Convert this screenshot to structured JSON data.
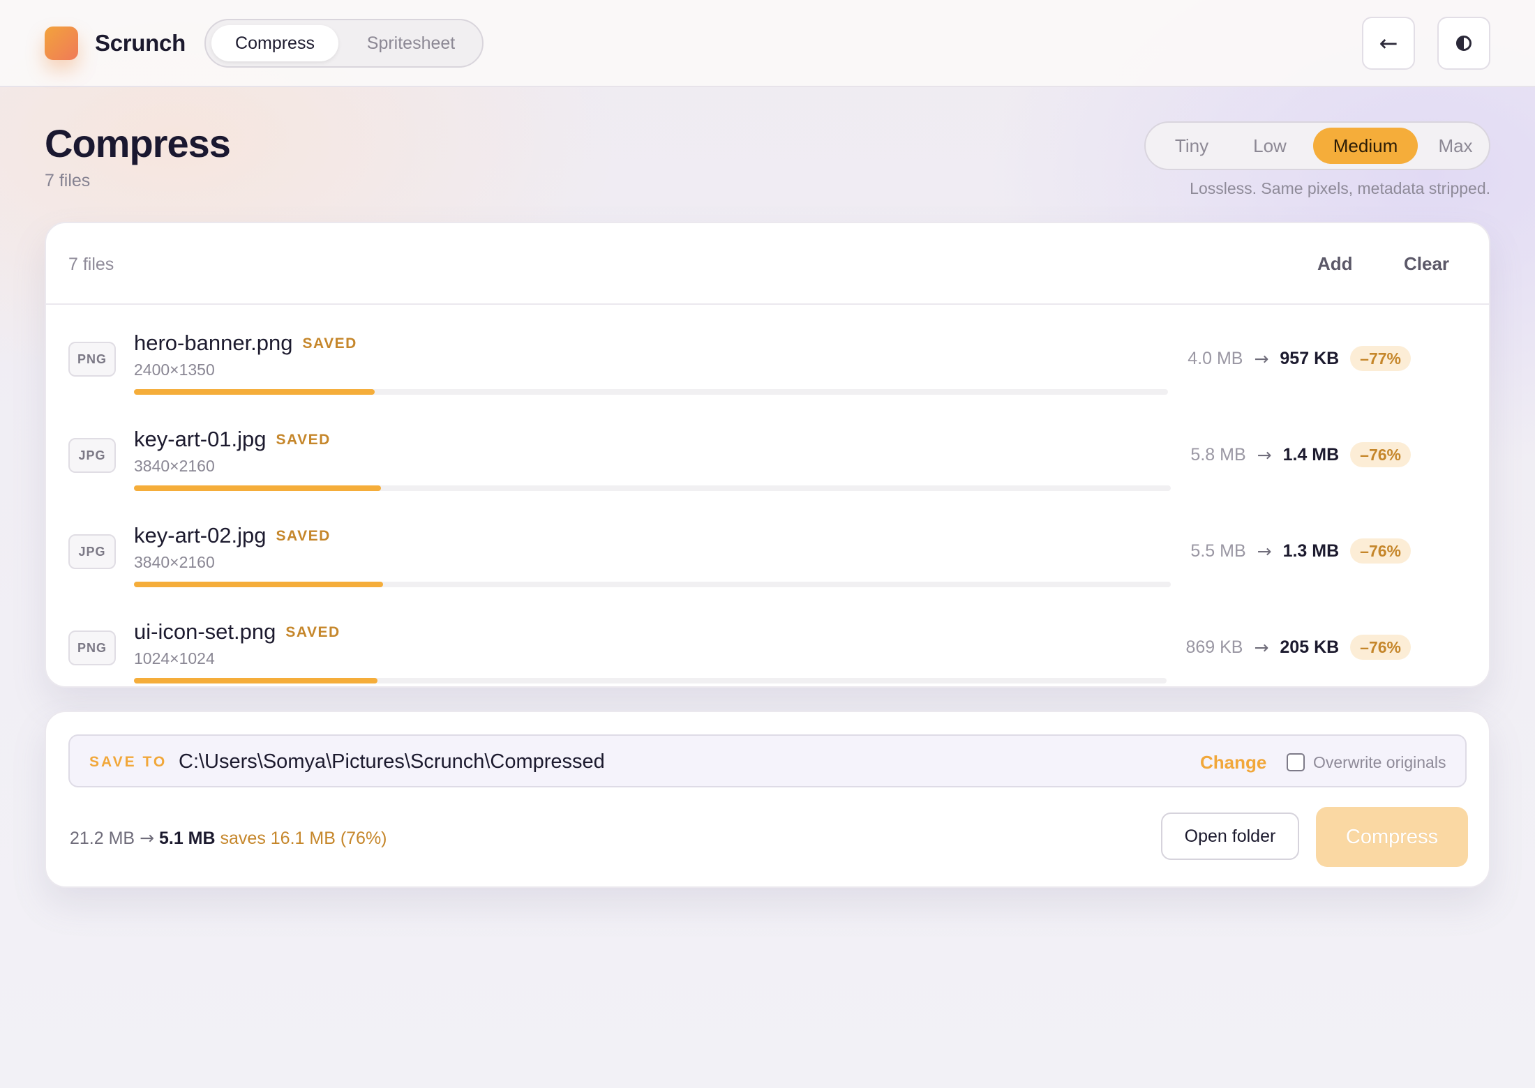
{
  "app": {
    "name": "Scrunch",
    "tabs": [
      {
        "label": "Compress",
        "active": true
      },
      {
        "label": "Spritesheet",
        "active": false
      }
    ],
    "back_icon": "arrow-left-icon",
    "theme_icon": "contrast-icon",
    "accent_color": "#f5ad3a"
  },
  "page": {
    "title": "Compress",
    "subtitle": "7 files"
  },
  "quality": {
    "options": [
      "Tiny",
      "Low",
      "Medium",
      "Max"
    ],
    "selected": "Medium",
    "hint": "Lossless. Same pixels, metadata stripped."
  },
  "files": {
    "count_label": "7 files",
    "add_label": "Add",
    "clear_label": "Clear",
    "items": [
      {
        "type": "PNG",
        "name": "hero-banner.png",
        "status": "SAVED",
        "dims": "2400×1350",
        "before": "4.0 MB",
        "after": "957 KB",
        "pct": "–77%",
        "progress": 0.233
      },
      {
        "type": "JPG",
        "name": "key-art-01.jpg",
        "status": "SAVED",
        "dims": "3840×2160",
        "before": "5.8 MB",
        "after": "1.4 MB",
        "pct": "–76%",
        "progress": 0.238
      },
      {
        "type": "JPG",
        "name": "key-art-02.jpg",
        "status": "SAVED",
        "dims": "3840×2160",
        "before": "5.5 MB",
        "after": "1.3 MB",
        "pct": "–76%",
        "progress": 0.24
      },
      {
        "type": "PNG",
        "name": "ui-icon-set.png",
        "status": "SAVED",
        "dims": "1024×1024",
        "before": "869 KB",
        "after": "205 KB",
        "pct": "–76%",
        "progress": 0.236
      }
    ]
  },
  "save": {
    "label": "SAVE TO",
    "path": "C:\\Users\\Somya\\Pictures\\Scrunch\\Compressed",
    "change_label": "Change",
    "overwrite_label": "Overwrite originals",
    "overwrite_checked": false
  },
  "summary": {
    "before": "21.2 MB",
    "arrow": "→",
    "after": "5.1 MB",
    "saves": "saves 16.1 MB (76%)"
  },
  "actions": {
    "open_folder_label": "Open folder",
    "compress_label": "Compress"
  }
}
